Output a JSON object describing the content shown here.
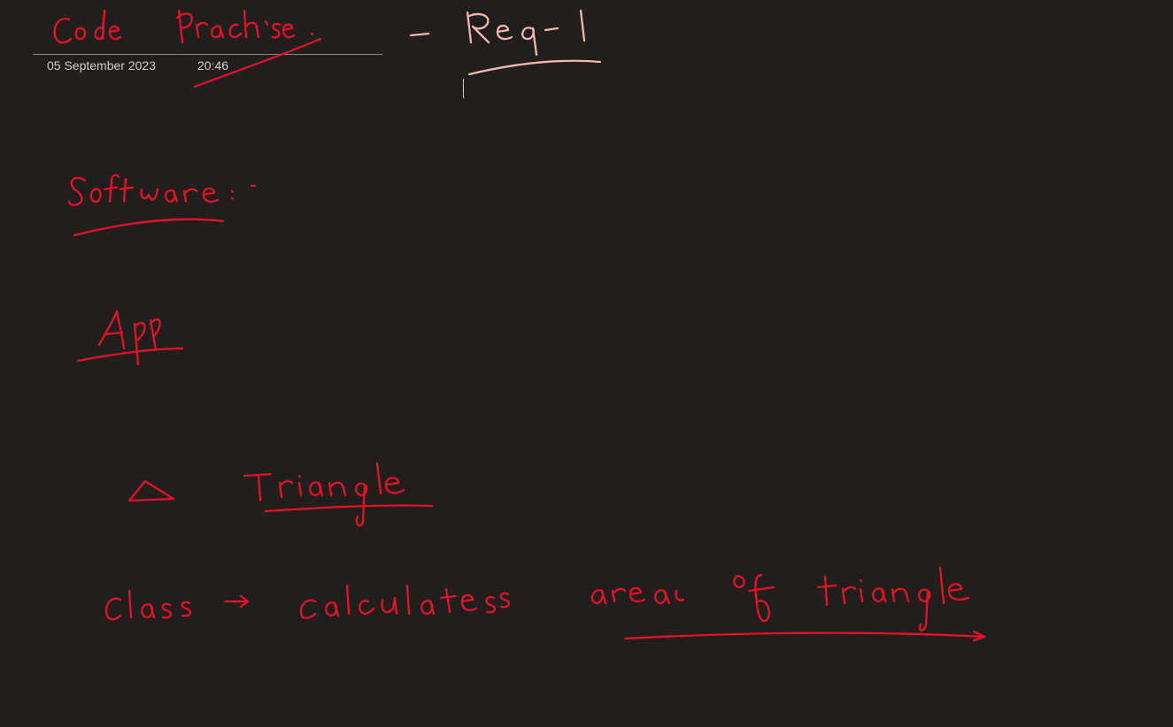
{
  "page": {
    "date": "05 September 2023",
    "time": "20:46"
  },
  "ink": {
    "colors": {
      "primary": "#e81123",
      "highlight": "#f4b6a8",
      "background": "#201f1e",
      "meta_text": "#d2d0ce"
    },
    "strokes": [
      {
        "name": "title-code-practise",
        "text": "code Prac'se"
      },
      {
        "name": "title-strike-through"
      },
      {
        "name": "title-dash"
      },
      {
        "name": "title-req-1",
        "text": "Req-1"
      },
      {
        "name": "req-1-underline"
      },
      {
        "name": "software",
        "text": "Software :-"
      },
      {
        "name": "software-underline"
      },
      {
        "name": "app",
        "text": "App"
      },
      {
        "name": "app-underline"
      },
      {
        "name": "triangle-symbol"
      },
      {
        "name": "triangle-word",
        "text": "Triangle"
      },
      {
        "name": "triangle-underline"
      },
      {
        "name": "class-calculates-area",
        "text": "class → calculates area of triangle"
      },
      {
        "name": "area-of-triangle-underline"
      }
    ]
  }
}
